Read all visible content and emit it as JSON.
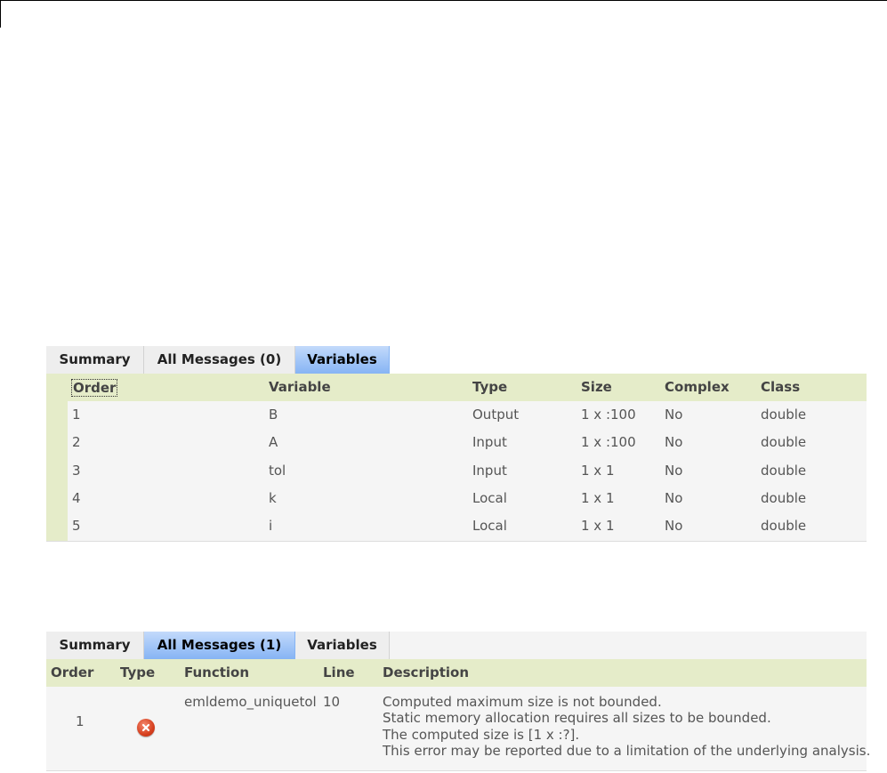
{
  "tabs_variables_view": {
    "summary": "Summary",
    "all_messages": "All Messages (0)",
    "variables": "Variables"
  },
  "variables_table": {
    "headers": [
      "Order",
      "Variable",
      "Type",
      "Size",
      "Complex",
      "Class"
    ],
    "rows": [
      [
        "1",
        "B",
        "Output",
        "1 x :100",
        "No",
        "double"
      ],
      [
        "2",
        "A",
        "Input",
        "1 x :100",
        "No",
        "double"
      ],
      [
        "3",
        "tol",
        "Input",
        "1 x 1",
        "No",
        "double"
      ],
      [
        "4",
        "k",
        "Local",
        "1 x 1",
        "No",
        "double"
      ],
      [
        "5",
        "i",
        "Local",
        "1 x 1",
        "No",
        "double"
      ]
    ]
  },
  "tabs_messages_view": {
    "summary": "Summary",
    "all_messages": "All Messages (1)",
    "variables": "Variables"
  },
  "messages_table": {
    "headers": [
      "Order",
      "Type",
      "Function",
      "Line",
      "Description"
    ],
    "rows": [
      {
        "order": "1",
        "type_icon": "error-icon",
        "function": "emldemo_uniquetol",
        "line": "10",
        "description": [
          "Computed maximum size is not bounded.",
          "Static memory allocation requires all sizes to be bounded.",
          "The computed size is [1 x :?].",
          "This error may be reported due to a limitation of the underlying analysis."
        ]
      }
    ]
  },
  "colors": {
    "active_tab": "#86b4f4",
    "header_band": "#e5ecc9",
    "error": "#d6401f"
  }
}
